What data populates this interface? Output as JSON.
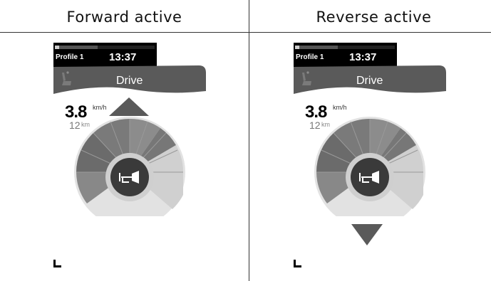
{
  "columns": [
    {
      "title": "Forward active",
      "status": {
        "profile": "Profile 1",
        "time": "13:37"
      },
      "mode": "Drive",
      "speed": {
        "value": "3.8",
        "unit": "km/h"
      },
      "distance": {
        "value": "12",
        "unit": "km"
      },
      "direction_indicator": "up-arrow-icon"
    },
    {
      "title": "Reverse active",
      "status": {
        "profile": "Profile 1",
        "time": "13:37"
      },
      "mode": "Drive",
      "speed": {
        "value": "3.8",
        "unit": "km/h"
      },
      "distance": {
        "value": "12",
        "unit": "km"
      },
      "direction_indicator": "down-arrow-icon"
    }
  ],
  "colors": {
    "background": "#ffffff",
    "status_bar": "#000000",
    "mode_banner": "#5a5a5a",
    "gauge_dark": "#6b6b6b",
    "gauge_mid": "#8c8c8c",
    "gauge_light": "#cfcfcf",
    "horn_button": "#3a3a3a"
  }
}
